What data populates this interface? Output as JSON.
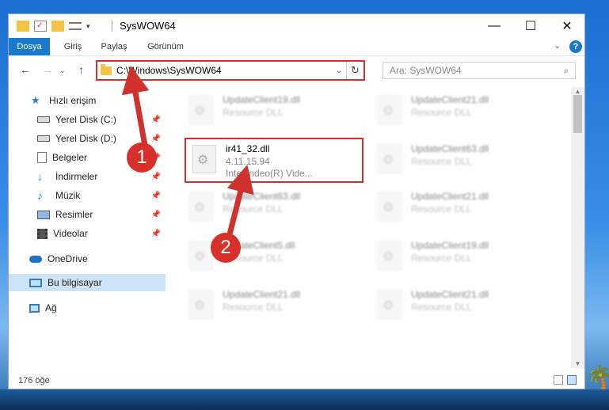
{
  "window": {
    "title": "SysWOW64",
    "minimize_glyph": "—",
    "maximize_glyph": "☐",
    "close_glyph": "✕"
  },
  "ribbon": {
    "tabs": [
      {
        "label": "Dosya",
        "active": true
      },
      {
        "label": "Giriş",
        "active": false
      },
      {
        "label": "Paylaş",
        "active": false
      },
      {
        "label": "Görünüm",
        "active": false
      }
    ],
    "expand_glyph": "⌄",
    "help_glyph": "?"
  },
  "address_bar": {
    "path": "C:\\Windows\\SysWOW64",
    "back_glyph": "←",
    "forward_glyph": "→",
    "recent_glyph": "⌄",
    "up_glyph": "↑",
    "dropdown_glyph": "⌄",
    "refresh_glyph": "↻"
  },
  "search": {
    "placeholder": "Ara: SysWOW64",
    "icon": "search-icon"
  },
  "nav_pane": {
    "items": [
      {
        "label": "Hızlı erişim",
        "icon": "star-icon",
        "pinned": false
      },
      {
        "label": "Yerel Disk (C:)",
        "icon": "drive-icon",
        "pinned": true
      },
      {
        "label": "Yerel Disk (D:)",
        "icon": "drive-icon",
        "pinned": true
      },
      {
        "label": "Belgeler",
        "icon": "documents-icon",
        "pinned": true
      },
      {
        "label": "İndirmeler",
        "icon": "download-icon",
        "pinned": true
      },
      {
        "label": "Müzik",
        "icon": "music-icon",
        "pinned": true
      },
      {
        "label": "Resimler",
        "icon": "pictures-icon",
        "pinned": true
      },
      {
        "label": "Videolar",
        "icon": "videos-icon",
        "pinned": true
      },
      {
        "label": "OneDrive",
        "icon": "cloud-icon",
        "pinned": false
      },
      {
        "label": "Bu bilgisayar",
        "icon": "computer-icon",
        "pinned": false,
        "selected": true
      },
      {
        "label": "Ağ",
        "icon": "network-icon",
        "pinned": false
      }
    ],
    "pin_glyph": "📌"
  },
  "files": {
    "left": [
      {
        "name": "UpdateClient19.dll",
        "type": "Resource DLL"
      },
      {
        "name": "ir41_32.dll",
        "version": "4.11.15.94",
        "description": "Intel Indeo(R) Vide..."
      },
      {
        "name": "UpdateClient63.dll",
        "type": "Resource DLL"
      },
      {
        "name": "UpdateClient5.dll",
        "type": "Resource DLL"
      },
      {
        "name": "UpdateClient21.dll",
        "type": "Resource DLL"
      }
    ],
    "right": [
      {
        "name": "UpdateClient21.dll",
        "type": "Resource DLL"
      },
      {
        "name": "UpdateClient63.dll",
        "type": "Resource DLL"
      },
      {
        "name": "UpdateClient21.dll",
        "type": "Resource DLL"
      },
      {
        "name": "UpdateClient19.dll",
        "type": "Resource DLL"
      },
      {
        "name": "UpdateClient21.dll",
        "type": "Resource DLL"
      }
    ]
  },
  "status_bar": {
    "item_count": "176 öğe"
  },
  "annotations": {
    "callout_1": "1",
    "callout_2": "2",
    "accent_color": "#d0312d"
  }
}
